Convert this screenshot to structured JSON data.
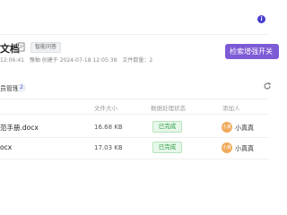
{
  "header": {
    "info_icon": "info-icon"
  },
  "document": {
    "title": "文档",
    "tag": "智能问答",
    "meta": {
      "created_short": "12:06:41",
      "updater": "豫柚 创建于 2024-07-18 12:05:38",
      "file_count": "文件数量：2"
    },
    "enhance_button": "检索增强开关"
  },
  "section": {
    "title": "员管理",
    "count": "2"
  },
  "table": {
    "headers": [
      "文件大小",
      "数据处理状态",
      "添加人"
    ],
    "rows": [
      {
        "name": "范手册.docx",
        "size": "16.68 KB",
        "status": "已完成",
        "avatar": "小真真",
        "adder": "小真真"
      },
      {
        "name": "ocx",
        "size": "17.03 KB",
        "status": "已完成",
        "avatar": "小真真",
        "adder": "小真真"
      }
    ]
  }
}
